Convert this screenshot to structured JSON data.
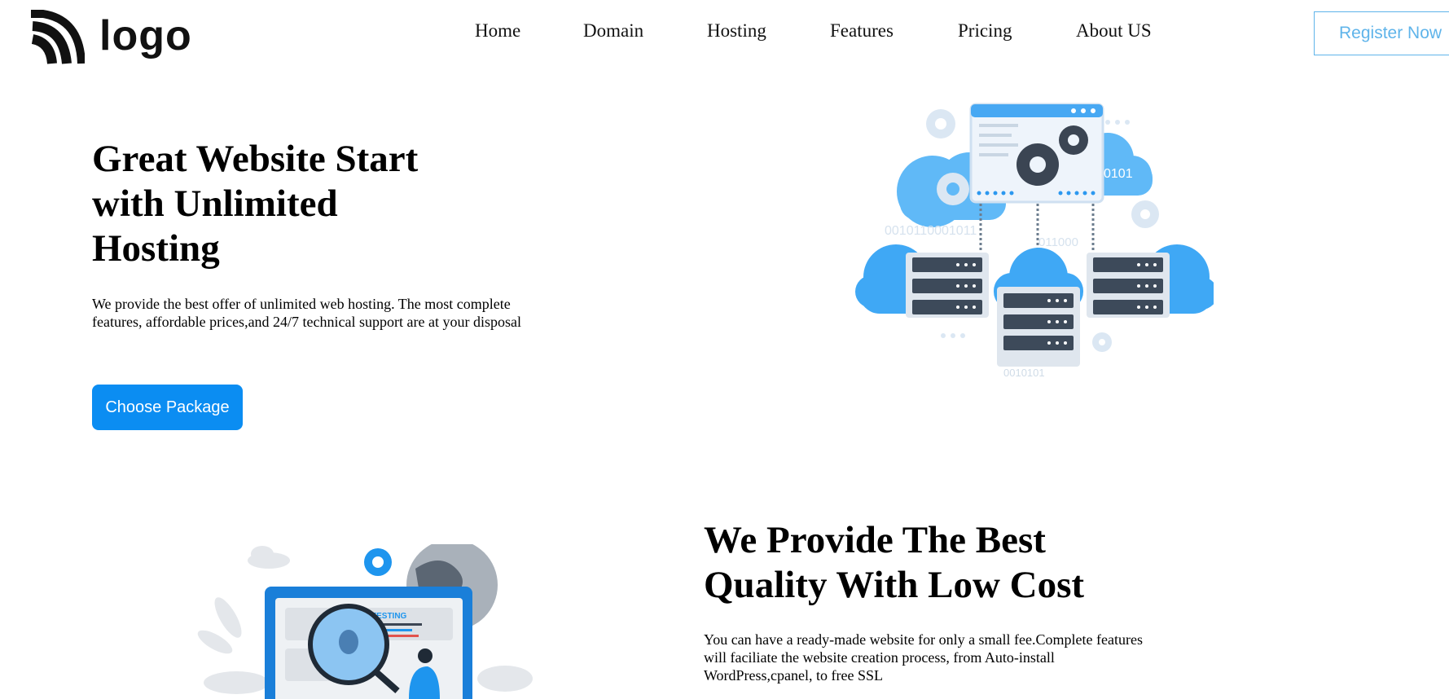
{
  "header": {
    "logo_text": "logo",
    "nav": [
      "Home",
      "Domain",
      "Hosting",
      "Features",
      "Pricing",
      "About US"
    ],
    "register_label": "Register Now"
  },
  "hero": {
    "title": "Great Website Start with Unlimited Hosting",
    "description": "We provide the best offer of unlimited web hosting. The most complete features, affordable prices,and 24/7 technical support are at your disposal",
    "cta_label": "Choose Package",
    "illustration": {
      "binary_1": "0101",
      "binary_2": "0010110001011",
      "binary_3": "011000",
      "binary_4": "0010101"
    }
  },
  "section2": {
    "title": "We Provide The Best Quality With Low Cost",
    "description": "You can have a ready-made website for only a small fee.Complete features will faciliate the website creation process, from Auto-install WordPress,cpanel, to free SSL",
    "illustration": {
      "label": "TESTING"
    }
  },
  "colors": {
    "accent": "#0b8df2",
    "register": "#5fb4ea",
    "cloud": "#4fb3f6",
    "server": "#3d4a5a"
  }
}
